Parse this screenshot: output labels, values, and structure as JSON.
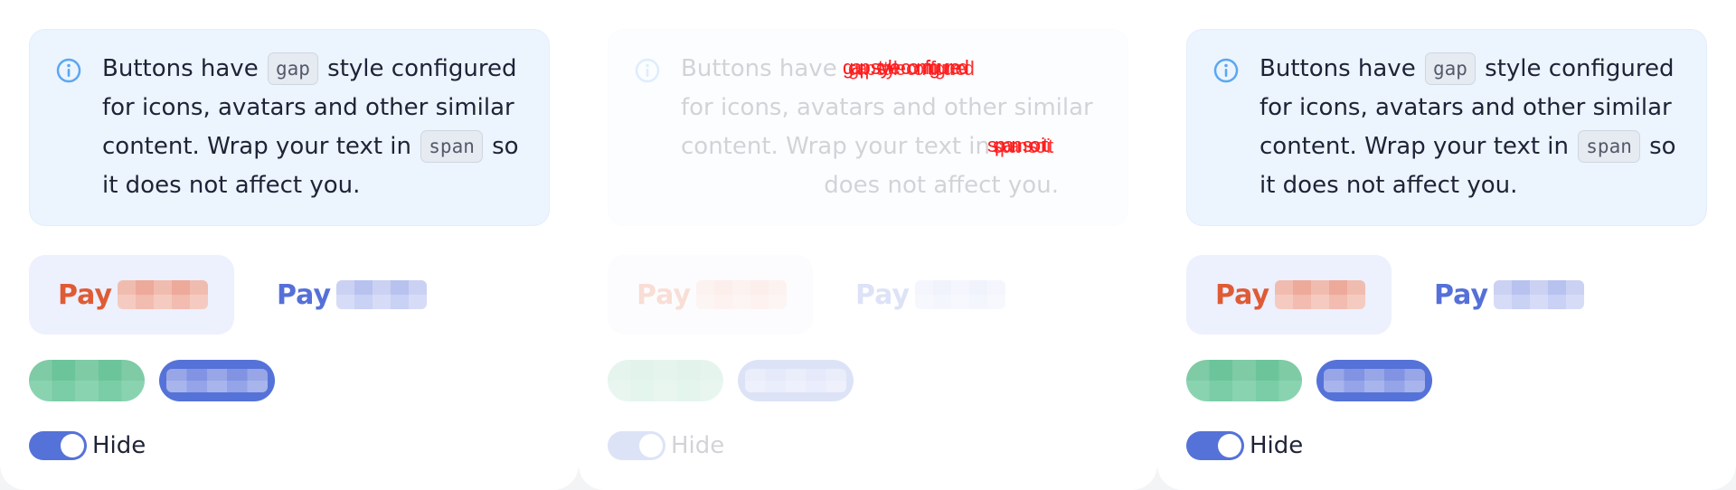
{
  "panels": [
    {
      "info": {
        "text_before_code1": "Buttons have",
        "code1": "gap",
        "text_after_code1": "style configured for icons, avatars and other similar content. Wrap your text in",
        "code2": "span",
        "text_after_code2": "so it does not affect you."
      },
      "buttons": {
        "pay_light_label": "Pay",
        "pay_subtle_label": "Pay"
      },
      "toggle": {
        "label": "Hide",
        "on": true
      }
    },
    {
      "info": {
        "text_before_code1": "Buttons have",
        "code1": "",
        "text_after_code1": "for icons, avatars and other similar content. Wrap your text in",
        "code2": "",
        "text_after_code2": "does not affect you."
      },
      "garbled": {
        "line1": "gap style configured",
        "line2": "span so it"
      },
      "buttons": {
        "pay_light_label": "Pay",
        "pay_subtle_label": "Pay"
      },
      "toggle": {
        "label": "Hide",
        "on": true
      }
    },
    {
      "info": {
        "text_before_code1": "Buttons have",
        "code1": "gap",
        "text_after_code1": "style configured for icons, avatars and other similar content. Wrap your text in",
        "code2": "span",
        "text_after_code2": "so it does not affect you."
      },
      "buttons": {
        "pay_light_label": "Pay",
        "pay_subtle_label": "Pay"
      },
      "toggle": {
        "label": "Hide",
        "on": true
      }
    }
  ],
  "colors": {
    "accent": "#5572d8",
    "pay_red": "#df5b35",
    "info_bg": "#ecf4fe",
    "info_icon": "#5aa7f2",
    "garble_red": "#ff1a1a"
  },
  "icons": {
    "info": "info-circle-icon"
  }
}
